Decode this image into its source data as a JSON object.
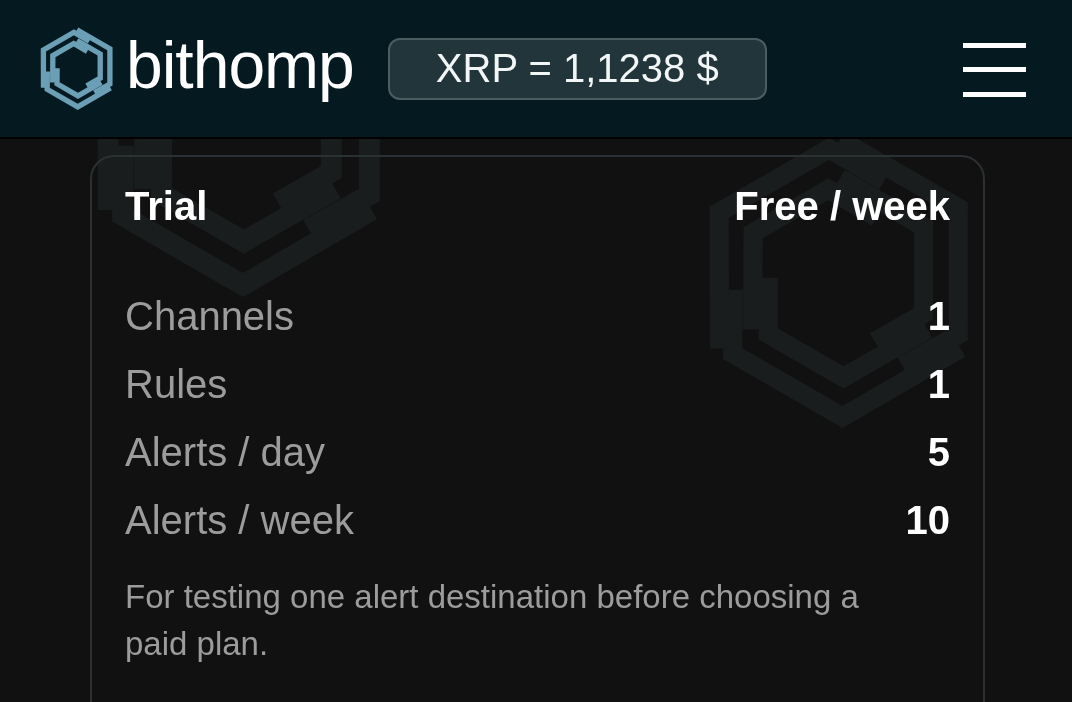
{
  "header": {
    "logo_text": "bithomp",
    "price": "XRP = 1,1238 $"
  },
  "plan": {
    "name": "Trial",
    "price": "Free / week",
    "features": [
      {
        "label": "Channels",
        "value": "1"
      },
      {
        "label": "Rules",
        "value": "1"
      },
      {
        "label": "Alerts / day",
        "value": "5"
      },
      {
        "label": "Alerts / week",
        "value": "10"
      }
    ],
    "description": "For testing one alert destination before choosing a paid plan."
  }
}
